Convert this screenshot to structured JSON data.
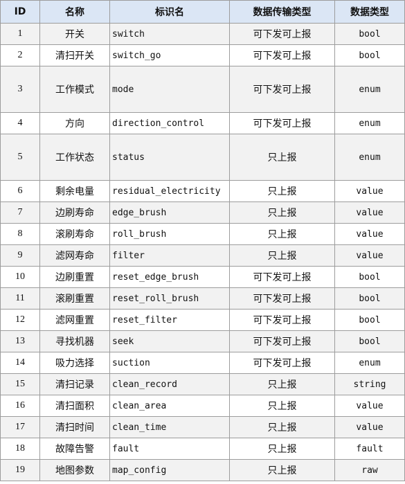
{
  "table": {
    "headers": [
      "ID",
      "名称",
      "标识名",
      "数据传输类型",
      "数据类型"
    ],
    "rows": [
      {
        "id": "1",
        "name": "开关",
        "code": "switch",
        "transfer": "可下发可上报",
        "type": "bool"
      },
      {
        "id": "2",
        "name": "清扫开关",
        "code": "switch_go",
        "transfer": "可下发可上报",
        "type": "bool"
      },
      {
        "id": "3",
        "name": "工作模式",
        "code": "mode",
        "transfer": "可下发可上报",
        "type": "enum"
      },
      {
        "id": "4",
        "name": "方向",
        "code": "direction_control",
        "transfer": "可下发可上报",
        "type": "enum"
      },
      {
        "id": "5",
        "name": "工作状态",
        "code": "status",
        "transfer": "只上报",
        "type": "enum"
      },
      {
        "id": "6",
        "name": "剩余电量",
        "code": "residual_electricity",
        "transfer": "只上报",
        "type": "value"
      },
      {
        "id": "7",
        "name": "边刷寿命",
        "code": "edge_brush",
        "transfer": "只上报",
        "type": "value"
      },
      {
        "id": "8",
        "name": "滚刷寿命",
        "code": "roll_brush",
        "transfer": "只上报",
        "type": "value"
      },
      {
        "id": "9",
        "name": "滤网寿命",
        "code": "filter",
        "transfer": "只上报",
        "type": "value"
      },
      {
        "id": "10",
        "name": "边刷重置",
        "code": "reset_edge_brush",
        "transfer": "可下发可上报",
        "type": "bool"
      },
      {
        "id": "11",
        "name": "滚刷重置",
        "code": "reset_roll_brush",
        "transfer": "可下发可上报",
        "type": "bool"
      },
      {
        "id": "12",
        "name": "滤网重置",
        "code": "reset_filter",
        "transfer": "可下发可上报",
        "type": "bool"
      },
      {
        "id": "13",
        "name": "寻找机器",
        "code": "seek",
        "transfer": "可下发可上报",
        "type": "bool"
      },
      {
        "id": "14",
        "name": "吸力选择",
        "code": "suction",
        "transfer": "可下发可上报",
        "type": "enum"
      },
      {
        "id": "15",
        "name": "清扫记录",
        "code": "clean_record",
        "transfer": "只上报",
        "type": "string"
      },
      {
        "id": "16",
        "name": "清扫面积",
        "code": "clean_area",
        "transfer": "只上报",
        "type": "value"
      },
      {
        "id": "17",
        "name": "清扫时间",
        "code": "clean_time",
        "transfer": "只上报",
        "type": "value"
      },
      {
        "id": "18",
        "name": "故障告警",
        "code": "fault",
        "transfer": "只上报",
        "type": "fault"
      },
      {
        "id": "19",
        "name": "地图参数",
        "code": "map_config",
        "transfer": "只上报",
        "type": "raw"
      }
    ]
  }
}
